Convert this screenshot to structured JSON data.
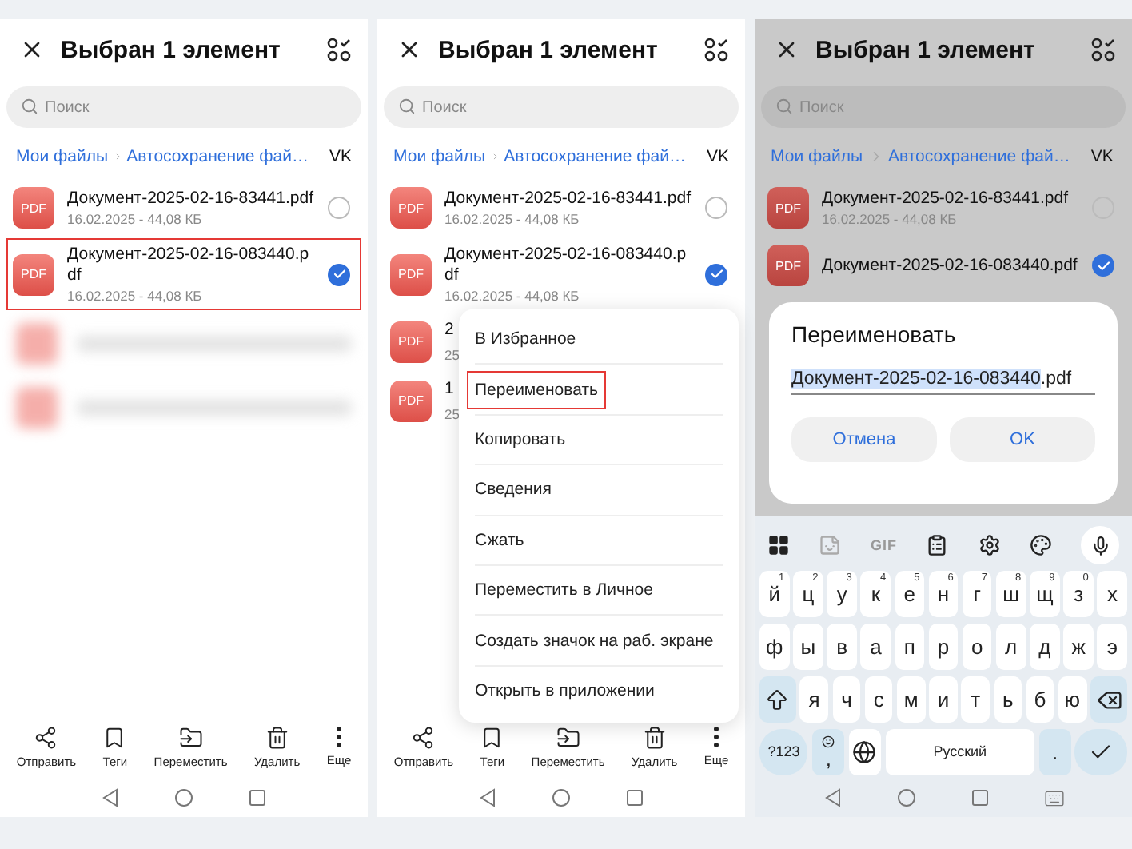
{
  "panels": [
    {
      "dimmed": false,
      "header": {
        "title": "Выбран 1 элемент"
      },
      "search": {
        "placeholder": "Поиск"
      },
      "breadcrumbs": [
        {
          "label": "Мои файлы",
          "current": false
        },
        {
          "label": "Автосохранение фай…",
          "current": false
        },
        {
          "label": "VK",
          "current": true
        }
      ],
      "files": [
        {
          "kind": "file",
          "type_label": "PDF",
          "name": "Документ-2025-02-16-83441.pdf",
          "meta": "16.02.2025 - 44,08 КБ",
          "selected": false,
          "highlighted": false
        },
        {
          "kind": "file",
          "type_label": "PDF",
          "name": "Документ-2025-02-16-083440.pdf",
          "meta": "16.02.2025 - 44,08 КБ",
          "selected": true,
          "highlighted": true
        },
        {
          "kind": "blurred"
        },
        {
          "kind": "blurred"
        }
      ],
      "toolbar": [
        {
          "kind": "send",
          "label": "Отправить"
        },
        {
          "kind": "tags",
          "label": "Теги"
        },
        {
          "kind": "move",
          "label": "Переместить"
        },
        {
          "kind": "delete",
          "label": "Удалить"
        },
        {
          "kind": "more",
          "label": "Еще"
        }
      ]
    },
    {
      "dimmed": false,
      "header": {
        "title": "Выбран 1 элемент"
      },
      "search": {
        "placeholder": "Поиск"
      },
      "breadcrumbs": [
        {
          "label": "Мои файлы",
          "current": false
        },
        {
          "label": "Автосохранение фай…",
          "current": false
        },
        {
          "label": "VK",
          "current": true
        }
      ],
      "files": [
        {
          "kind": "file",
          "type_label": "PDF",
          "name": "Документ-2025-02-16-83441.pdf",
          "meta": "16.02.2025 - 44,08 КБ",
          "selected": false,
          "highlighted": false
        },
        {
          "kind": "file",
          "type_label": "PDF",
          "name": "Документ-2025-02-16-083440.pdf",
          "meta": "16.02.2025 - 44,08 КБ",
          "selected": true,
          "highlighted": false
        },
        {
          "kind": "partial",
          "type_label": "PDF",
          "name": "2",
          "meta": "25"
        },
        {
          "kind": "partial",
          "type_label": "PDF",
          "name": "1",
          "meta": "25"
        }
      ],
      "menu": [
        {
          "label": "В Избранное",
          "highlighted": false
        },
        {
          "label": "Переименовать",
          "highlighted": true
        },
        {
          "label": "Копировать",
          "highlighted": false
        },
        {
          "label": "Сведения",
          "highlighted": false
        },
        {
          "label": "Сжать",
          "highlighted": false
        },
        {
          "label": "Переместить в Личное",
          "highlighted": false
        },
        {
          "label": "Создать значок на раб. экране",
          "highlighted": false
        },
        {
          "label": "Открыть в приложении",
          "highlighted": false
        }
      ],
      "toolbar": [
        {
          "kind": "send",
          "label": "Отправить"
        },
        {
          "kind": "tags",
          "label": "Теги"
        },
        {
          "kind": "move",
          "label": "Переместить"
        },
        {
          "kind": "delete",
          "label": "Удалить"
        },
        {
          "kind": "more",
          "label": "Еще"
        }
      ]
    },
    {
      "dimmed": true,
      "header": {
        "title": "Выбран 1 элемент"
      },
      "search": {
        "placeholder": "Поиск"
      },
      "breadcrumbs": [
        {
          "label": "Мои файлы",
          "current": false
        },
        {
          "label": "Автосохранение фай…",
          "current": false
        },
        {
          "label": "VK",
          "current": true
        }
      ],
      "files": [
        {
          "kind": "file",
          "type_label": "PDF",
          "name": "Документ-2025-02-16-83441.pdf",
          "meta": "16.02.2025 - 44,08 КБ",
          "selected": false,
          "highlighted": false
        },
        {
          "kind": "file",
          "type_label": "PDF",
          "name": "Документ-2025-02-16-083440.pdf",
          "selected": true,
          "highlighted": false
        }
      ],
      "dialog": {
        "title": "Переименовать",
        "value_selected": "Документ-2025-02-16-083440",
        "value_rest": ".pdf",
        "buttons": [
          {
            "label": "Отмена"
          },
          {
            "label": "OK"
          }
        ]
      },
      "keyboard": {
        "toolbar": [
          {
            "kind": "apps"
          },
          {
            "kind": "sticker"
          },
          {
            "kind": "gif",
            "label": "GIF"
          },
          {
            "kind": "clipboard"
          },
          {
            "kind": "settings"
          },
          {
            "kind": "palette"
          },
          {
            "kind": "mic"
          }
        ],
        "rows": [
          {
            "keys": [
              {
                "kind": "letter",
                "label": "й",
                "hint": "1"
              },
              {
                "kind": "letter",
                "label": "ц",
                "hint": "2"
              },
              {
                "kind": "letter",
                "label": "у",
                "hint": "3"
              },
              {
                "kind": "letter",
                "label": "к",
                "hint": "4"
              },
              {
                "kind": "letter",
                "label": "е",
                "hint": "5"
              },
              {
                "kind": "letter",
                "label": "н",
                "hint": "6"
              },
              {
                "kind": "letter",
                "label": "г",
                "hint": "7"
              },
              {
                "kind": "letter",
                "label": "ш",
                "hint": "8"
              },
              {
                "kind": "letter",
                "label": "щ",
                "hint": "9"
              },
              {
                "kind": "letter",
                "label": "з",
                "hint": "0"
              },
              {
                "kind": "letter",
                "label": "х"
              }
            ]
          },
          {
            "keys": [
              {
                "kind": "letter",
                "label": "ф"
              },
              {
                "kind": "letter",
                "label": "ы"
              },
              {
                "kind": "letter",
                "label": "в"
              },
              {
                "kind": "letter",
                "label": "а"
              },
              {
                "kind": "letter",
                "label": "п"
              },
              {
                "kind": "letter",
                "label": "р"
              },
              {
                "kind": "letter",
                "label": "о"
              },
              {
                "kind": "letter",
                "label": "л"
              },
              {
                "kind": "letter",
                "label": "д"
              },
              {
                "kind": "letter",
                "label": "ж"
              },
              {
                "kind": "letter",
                "label": "э"
              }
            ]
          },
          {
            "keys": [
              {
                "kind": "shift"
              },
              {
                "kind": "letter",
                "label": "я"
              },
              {
                "kind": "letter",
                "label": "ч"
              },
              {
                "kind": "letter",
                "label": "с"
              },
              {
                "kind": "letter",
                "label": "м"
              },
              {
                "kind": "letter",
                "label": "и"
              },
              {
                "kind": "letter",
                "label": "т"
              },
              {
                "kind": "letter",
                "label": "ь"
              },
              {
                "kind": "letter",
                "label": "б"
              },
              {
                "kind": "letter",
                "label": "ю"
              },
              {
                "kind": "backspace"
              }
            ]
          },
          {
            "keys": [
              {
                "kind": "mode",
                "label": "?123"
              },
              {
                "kind": "emoji",
                "label": ","
              },
              {
                "kind": "globe"
              },
              {
                "kind": "space",
                "label": "Русский"
              },
              {
                "kind": "period",
                "label": "."
              },
              {
                "kind": "enter"
              }
            ]
          }
        ]
      }
    }
  ]
}
